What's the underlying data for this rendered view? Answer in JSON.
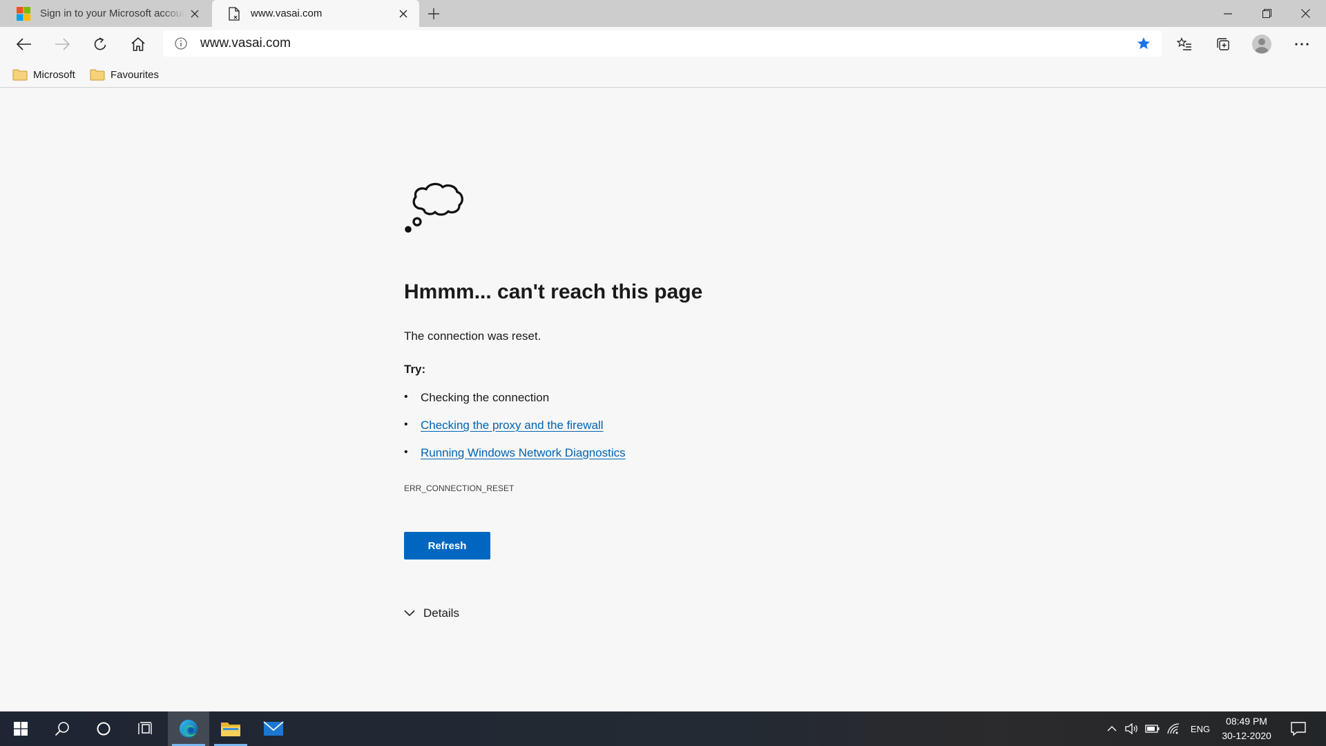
{
  "tabs": [
    {
      "title": "Sign in to your Microsoft account",
      "favicon": "microsoft-logo-icon",
      "active": false
    },
    {
      "title": "www.vasai.com",
      "favicon": "page-icon",
      "active": true
    }
  ],
  "address_bar": {
    "url": "www.vasai.com"
  },
  "bookmarks": [
    {
      "label": "Microsoft",
      "icon": "folder-icon"
    },
    {
      "label": "Favourites",
      "icon": "folder-icon"
    }
  ],
  "error_page": {
    "icon": "thought-cloud-icon",
    "headline": "Hmmm... can't reach this page",
    "message": "The connection was reset.",
    "try_label": "Try:",
    "suggestions": [
      {
        "text": "Checking the connection",
        "link": false
      },
      {
        "text": "Checking the proxy and the firewall",
        "link": true
      },
      {
        "text": "Running Windows Network Diagnostics",
        "link": true
      }
    ],
    "error_code": "ERR_CONNECTION_RESET",
    "refresh_label": "Refresh",
    "details_label": "Details"
  },
  "taskbar": {
    "apps": [
      "start-icon",
      "search-icon",
      "cortana-icon",
      "task-view-icon",
      "edge-icon",
      "file-explorer-icon",
      "mail-icon"
    ],
    "language": "ENG",
    "time": "08:49 PM",
    "date": "30-12-2020"
  },
  "colors": {
    "accent": "#0067c0",
    "link": "#0063b1",
    "star": "#1a73e8",
    "tabstrip": "#cdcdcd",
    "page_bg": "#f7f7f7"
  }
}
